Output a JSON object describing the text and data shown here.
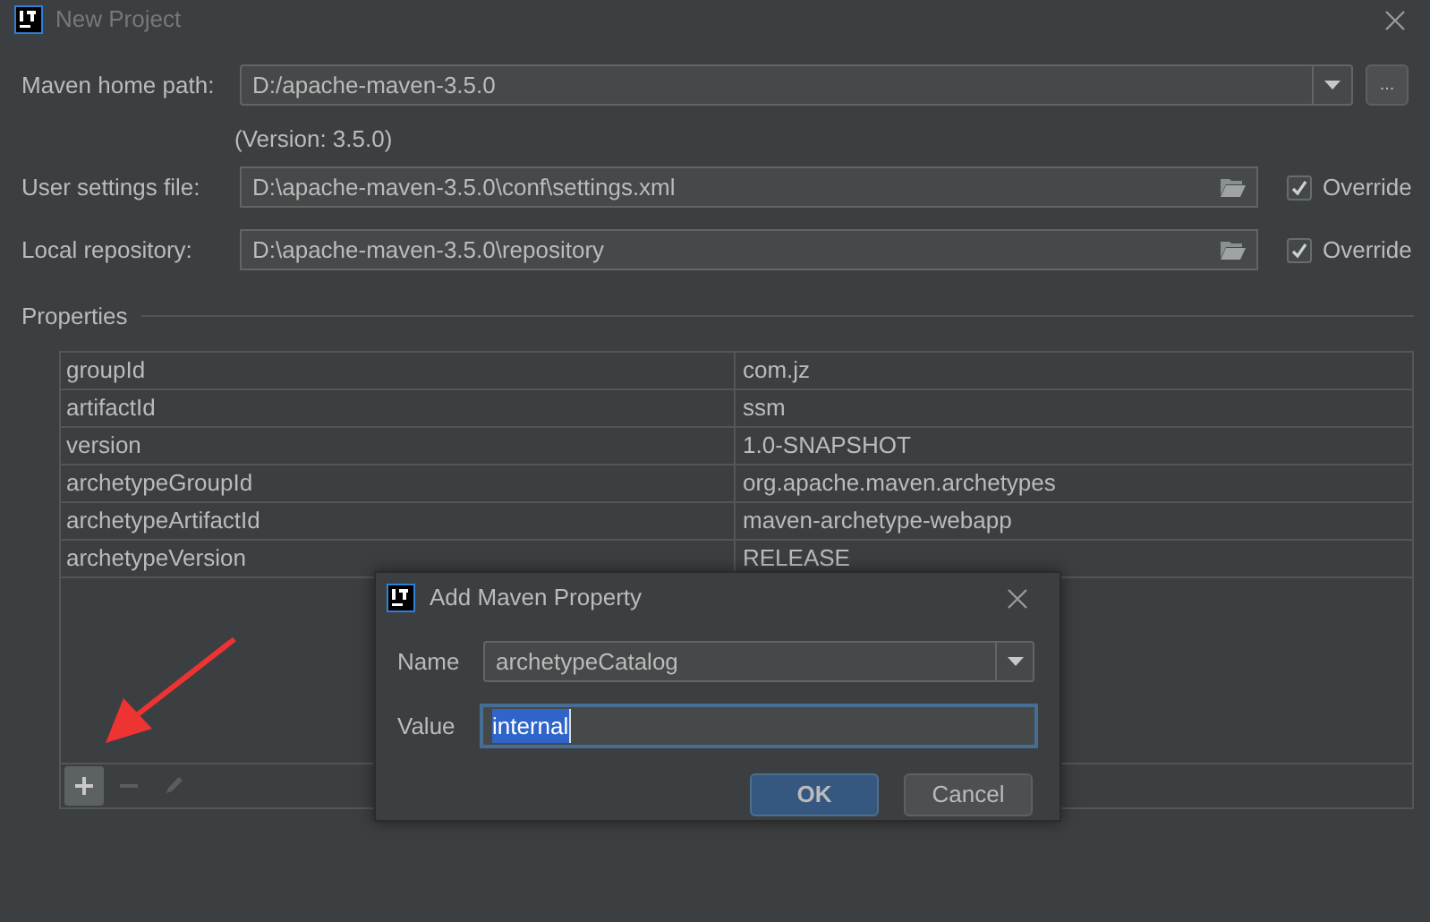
{
  "window": {
    "title": "New Project"
  },
  "maven_home": {
    "label": "Maven home path:",
    "value": "D:/apache-maven-3.5.0",
    "browse_button": "...",
    "version_note": "(Version: 3.5.0)"
  },
  "paths": [
    {
      "label": "User settings file:",
      "value": "D:\\apache-maven-3.5.0\\conf\\settings.xml",
      "override": {
        "label": "Override",
        "checked": true
      }
    },
    {
      "label": "Local repository:",
      "value": "D:\\apache-maven-3.5.0\\repository",
      "override": {
        "label": "Override",
        "checked": true
      }
    }
  ],
  "properties": {
    "title": "Properties",
    "rows": [
      {
        "key": "groupId",
        "value": "com.jz"
      },
      {
        "key": "artifactId",
        "value": "ssm"
      },
      {
        "key": "version",
        "value": "1.0-SNAPSHOT"
      },
      {
        "key": "archetypeGroupId",
        "value": "org.apache.maven.archetypes"
      },
      {
        "key": "archetypeArtifactId",
        "value": "maven-archetype-webapp"
      },
      {
        "key": "archetypeVersion",
        "value": "RELEASE"
      }
    ],
    "toolbar": [
      {
        "kind": "add",
        "disabled": false,
        "hovered": true
      },
      {
        "kind": "remove",
        "disabled": true,
        "hovered": false
      },
      {
        "kind": "edit",
        "disabled": true,
        "hovered": false
      }
    ]
  },
  "dialog": {
    "title": "Add Maven Property",
    "name": {
      "label": "Name",
      "value": "archetypeCatalog"
    },
    "value": {
      "label": "Value",
      "value": "internal",
      "selected": true
    },
    "buttons": [
      {
        "label": "OK",
        "default": true
      },
      {
        "label": "Cancel",
        "default": false
      }
    ]
  }
}
